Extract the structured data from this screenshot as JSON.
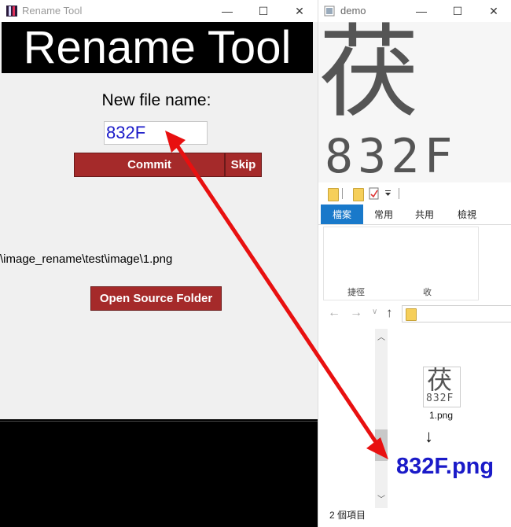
{
  "rename_window": {
    "title": "Rename Tool",
    "banner": "Rename Tool",
    "new_name_label": "New file name:",
    "new_name_value": "832F",
    "commit_label": "Commit",
    "skip_label": "Skip",
    "source_path": "\\image_rename\\test\\image\\1.png",
    "open_folder_label": "Open Source Folder"
  },
  "demo_window": {
    "title": "demo",
    "glyph": "茯",
    "code": "832F"
  },
  "explorer": {
    "tabs": [
      "檔案",
      "常用",
      "共用",
      "檢視"
    ],
    "ribbon_fragment_1": "捷徑",
    "ribbon_fragment_2": "收",
    "thumb_glyph": "茯",
    "thumb_code": "832F",
    "file_name": "1.png",
    "status": "2 個項目"
  },
  "annotation": {
    "down_arrow": "↓",
    "result_label": "832F.png",
    "arrow_color": "#e81010"
  },
  "window_controls": {
    "minimize": "—",
    "maximize": "☐",
    "close": "✕"
  }
}
